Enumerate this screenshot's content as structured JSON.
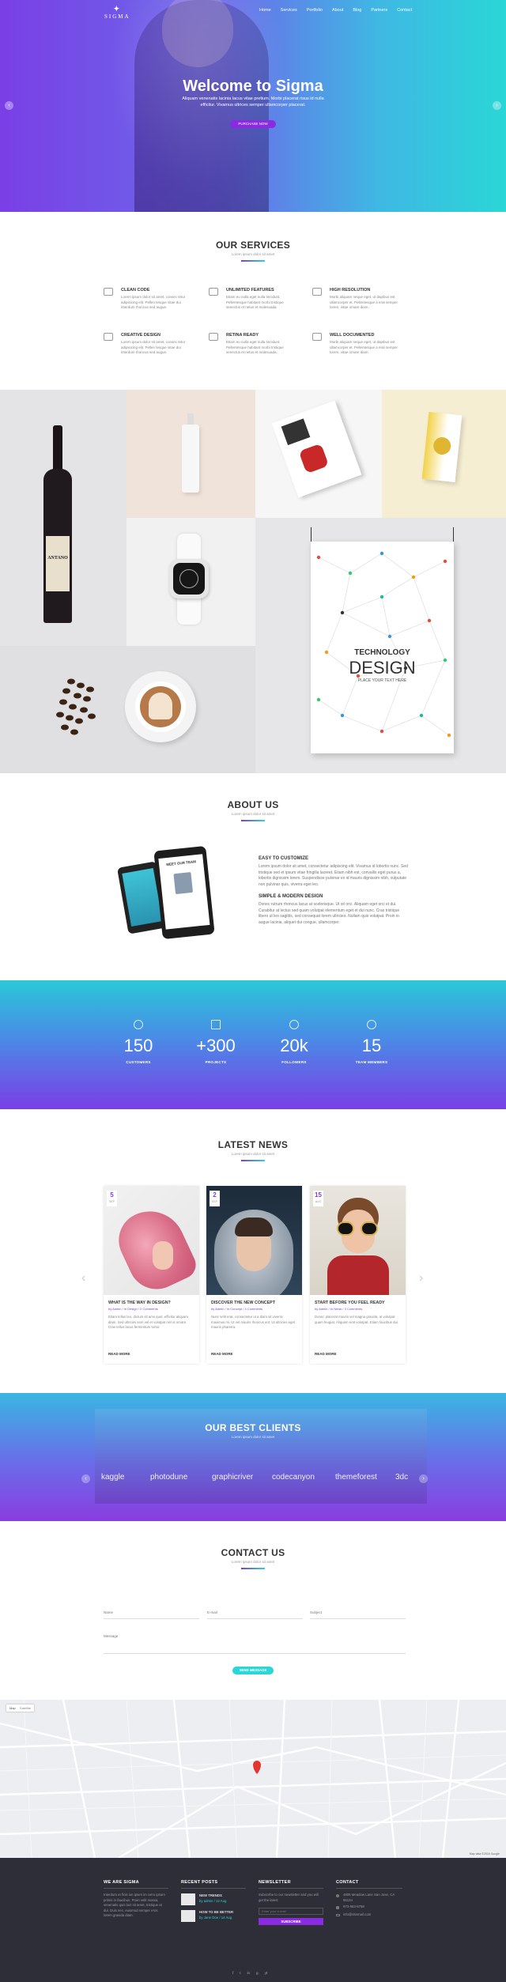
{
  "brand": {
    "logo_text": "SIGMA"
  },
  "nav": [
    "Home",
    "Services",
    "Portfolio",
    "About",
    "Blog",
    "Partners",
    "Contact"
  ],
  "hero": {
    "title": "Welcome to Sigma",
    "lead": "Aliquam venenatis lacinia lacus vitae pretium. Morbi placerat risus id nulla efficitur. Vivamus ultrices semper ullamcorper placerat.",
    "cta": "PURCHASE NOW",
    "prev": "‹",
    "next": "›"
  },
  "services": {
    "title": "OUR SERVICES",
    "subtitle": "Lorem ipsum dolor sit amet",
    "items": [
      {
        "title": "CLEAN CODE",
        "text": "Lorem ipsum dolor sit amet, consec tetur adipisicing elit. Pellen tesque vitae dui interdum rhoncus sed augue."
      },
      {
        "title": "UNLIMITED FEATURES",
        "text": "Etiam eu nulla eget nulla tincidunt. Pellentesque habitant morbi tristique senectus et netus et malesuada."
      },
      {
        "title": "HIGH RESOLUTION",
        "text": "Morbi aliquam neque eget, ut dapibus est ullamcorper et. Pellentesque a erat semper lorem, vitae ornare diam."
      },
      {
        "title": "CREATIVE DESIGN",
        "text": "Lorem ipsum dolor sit amet, consec tetur adipisicing elit. Pellen tesque vitae dui interdum rhoncus sed augue."
      },
      {
        "title": "RETINA READY",
        "text": "Etiam eu nulla eget nulla tincidunt. Pellentesque habitant morbi tristique senectus et netus et malesuada."
      },
      {
        "title": "WELL DOCUMENTED",
        "text": "Morbi aliquam neque eget, ut dapibus est ullamcorper et. Pellentesque a erat semper lorem, vitae ornare diam."
      }
    ]
  },
  "portfolio": {
    "wine_label": "ANTANO",
    "poster_title_1": "TECHNOLOGY",
    "poster_title_2": "DESIGN",
    "poster_sub": "PLACE YOUR TEXT HERE"
  },
  "about": {
    "title": "ABOUT US",
    "subtitle": "Lorem ipsum dolor sit amet",
    "tablet_text": "MEET OUR TEAM",
    "blocks": [
      {
        "title": "EASY TO CUSTOMIZE",
        "text": "Lorem ipsum dolor sit amet, consectetur adipiscing elit. Vivamus id lobortis nunc. Sed tristique sed et ipsum vitae fringilla laoreet. Etiam nibh est, convallis eget purus a, lobortis dignissim lorem. Suspendisse pulvinar ex id mauris dignissim nibh, vulputate non pulvinar quis, viverra eget leo."
      },
      {
        "title": "SIMPLE & MODERN DESIGN",
        "text": "Donec rutrum rhoncus lacus at scelerisque. Ut sit orci. Aliquam eget orci et dui. Curabitur at lectus sed quam volutpat elementum eget et dui nunc. Cras tristique libero ut leo sagittis, sed consequat lorem ultricies. Nullam quis volutpat. Proin in augue lacinia, aliquet dui congue, ullamcorper."
      }
    ]
  },
  "stats": [
    {
      "value": "150",
      "label": "CUSTOMERS"
    },
    {
      "value": "+300",
      "label": "PROJECTS"
    },
    {
      "value": "20k",
      "label": "FOLLOWERS"
    },
    {
      "value": "15",
      "label": "TEAM MEMBERS"
    }
  ],
  "news": {
    "title": "LATEST NEWS",
    "subtitle": "Lorem ipsum dolor sit amet",
    "read_more": "READ MORE",
    "prev": "‹",
    "next": "›",
    "posts": [
      {
        "day": "5",
        "month": "SEP",
        "title": "WHAT IS THE WAY IN DESIGN?",
        "meta": "by Admin / In Design / 2 Comments",
        "text": "Etiam tellus leo, dictum sit ams quet, efficitur aliquam diam. Sed ultricies sem vel et volutpat nisl ut ornare. Cras tellus lacus fermentum tortor."
      },
      {
        "day": "2",
        "month": "SEP",
        "title": "DISCOVER THE NEW CONCEPT",
        "meta": "by Admin / In Concept / 4 Comments",
        "text": "Nunc velit erat, consectetur ut a diam sit viverra maximus mi. Ut vel mauris rhoncus ant. Ut ultricies eget mauris pharetra."
      },
      {
        "day": "15",
        "month": "AUG",
        "title": "START BEFORE YOU FEEL READY",
        "meta": "by Admin / In News / 3 Comments",
        "text": "Donec placerat mauris vel magna gravida, at volutpat quam feugiat. Aliquam erat volutpat. Etiam faucibus dui."
      }
    ]
  },
  "clients": {
    "title": "OUR BEST CLIENTS",
    "subtitle": "Lorem ipsum dolor sit amet",
    "prev": "‹",
    "next": "›",
    "logos": [
      "kaggle",
      "photodune",
      "graphicriver",
      "codecanyon",
      "themeforest",
      "3dc"
    ]
  },
  "contact": {
    "title": "CONTACT US",
    "subtitle": "Lorem ipsum dolor sit amet",
    "name_label": "Name",
    "email_label": "E-mail",
    "subject_label": "Subject",
    "message_label": "Message",
    "send": "SEND MESSAGE"
  },
  "map": {
    "type_map": "Map",
    "type_sat": "Satellite",
    "attribution": "Map data ©2016 Google"
  },
  "footer": {
    "about_title": "WE ARE SIGMA",
    "about_text": "Interdum et finis ion ipsen im ceiro ipsum primis in faucibus. Proin velit massa, venenatis quis luct sit amet, tristique at dui. Duis nec, euismod semper eros lorem gravida diam.",
    "recent_title": "RECENT POSTS",
    "recent": [
      {
        "title": "NEW TRENDS",
        "meta": "by admin / 12 Aug"
      },
      {
        "title": "HOW TO BE BETTER",
        "meta": "by Jane Doe / 14 Aug"
      }
    ],
    "newsletter_title": "NEWSLETTER",
    "newsletter_text": "Subscribe to our newsletter and you will get the latest",
    "newsletter_placeholder": "Enter your e-mail",
    "subscribe": "SUBSCRIBE",
    "contact_title": "CONTACT",
    "address": "4808 Meadow Lane San Jose, CA 95134",
    "phone": "973-953-8758",
    "email": "info@sitemail.com",
    "social": [
      "f",
      "t",
      "in",
      "g",
      "yt"
    ]
  },
  "colors": {
    "accent": "#8a2be2",
    "teal": "#2ad6d6",
    "violet": "#7a3fe6"
  }
}
